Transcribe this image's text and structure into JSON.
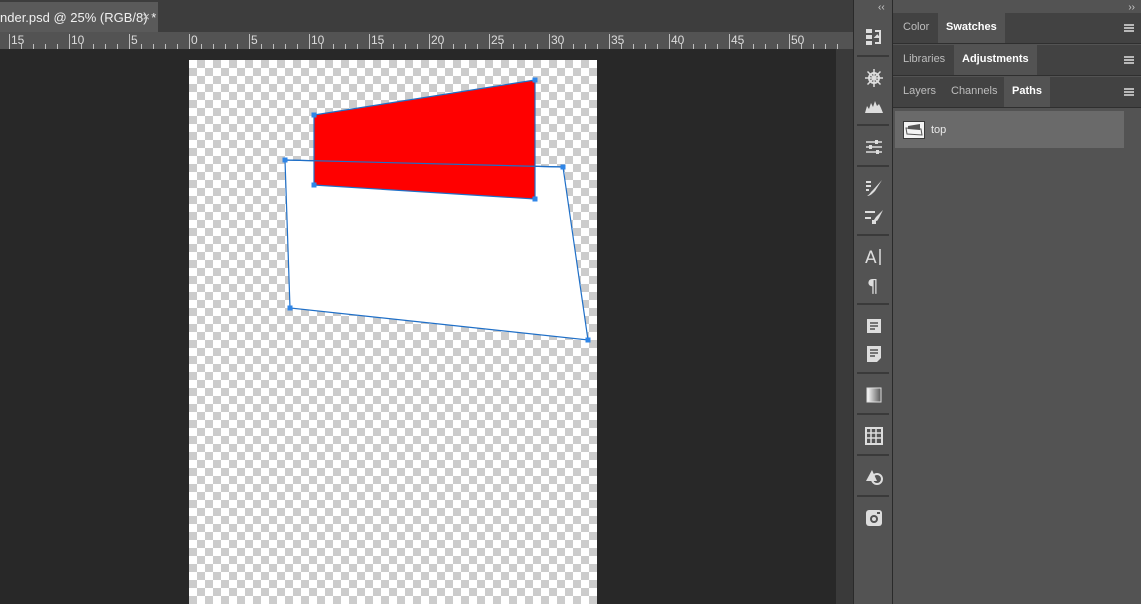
{
  "document_tab": {
    "title": "nder.psd @ 25% (RGB/8) *",
    "close": "×"
  },
  "ruler": {
    "labels": [
      "15",
      "10",
      "5",
      "0",
      "5",
      "10",
      "15",
      "20",
      "25",
      "30",
      "35",
      "40",
      "45",
      "50"
    ]
  },
  "strip": {
    "collapse": "‹‹"
  },
  "panels": {
    "collapse": "››",
    "group1": {
      "tabs": [
        "Color",
        "Swatches"
      ],
      "active": "Swatches"
    },
    "group2": {
      "tabs": [
        "Libraries",
        "Adjustments"
      ],
      "active": "Adjustments"
    },
    "group3": {
      "tabs": [
        "Layers",
        "Channels",
        "Paths"
      ],
      "active": "Paths"
    },
    "paths": [
      {
        "name": "top"
      }
    ]
  },
  "tool_icons": [
    "history-brush-icon",
    "settings-wheel-icon",
    "histogram-icon",
    "properties-sliders-icon",
    "brush-icon",
    "brush-settings-icon",
    "character-icon",
    "paragraph-icon",
    "info-icon",
    "notes-icon",
    "gradients-icon",
    "navigator-grid-icon",
    "shapes-icon",
    "camera-icon"
  ],
  "colors": {
    "red_shape": "#ff0000",
    "white_shape": "#ffffff",
    "path_stroke": "#1f6fc7",
    "anchor": "#2f86e8"
  }
}
